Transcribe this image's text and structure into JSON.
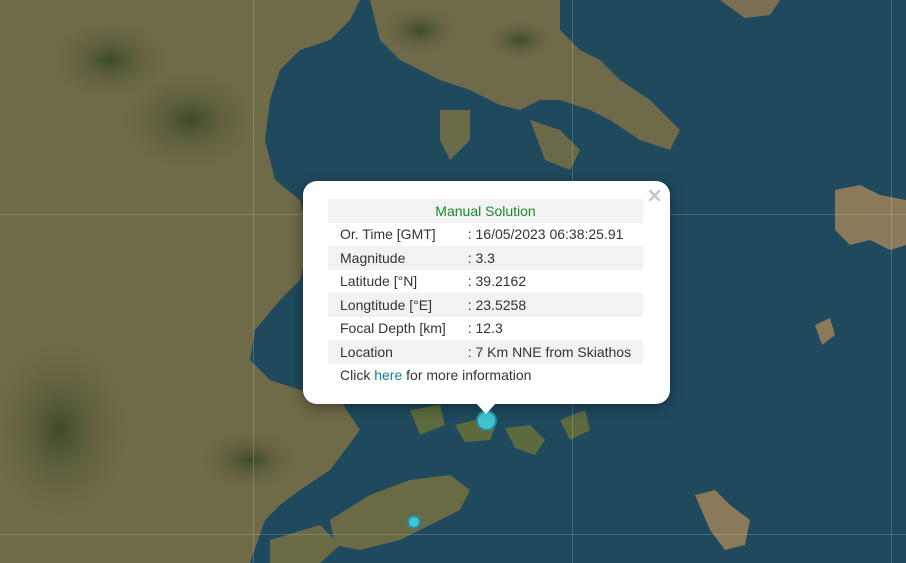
{
  "popup": {
    "title": "Manual Solution",
    "close_symbol": "×",
    "rows": [
      {
        "label": "Or. Time [GMT]",
        "value": ": 16/05/2023 06:38:25.91"
      },
      {
        "label": "Magnitude",
        "value": ": 3.3"
      },
      {
        "label": "Latitude [°N]",
        "value": ": 39.2162"
      },
      {
        "label": "Longtitude [°E]",
        "value": ": 23.5258"
      },
      {
        "label": "Focal Depth [km]",
        "value": ": 12.3"
      },
      {
        "label": "Location",
        "value": ": 7 Km NNE from Skiathos"
      }
    ],
    "more_prefix": "Click ",
    "more_link": "here",
    "more_suffix": " for more information"
  },
  "colors": {
    "sea": "#1f4a5e",
    "land": "#6f6a48",
    "marker": "#3fc4d2",
    "title_green": "#1a8a2a",
    "link": "#1a7a9a"
  },
  "icons": {
    "close": "close-icon",
    "marker": "earthquake-marker"
  }
}
